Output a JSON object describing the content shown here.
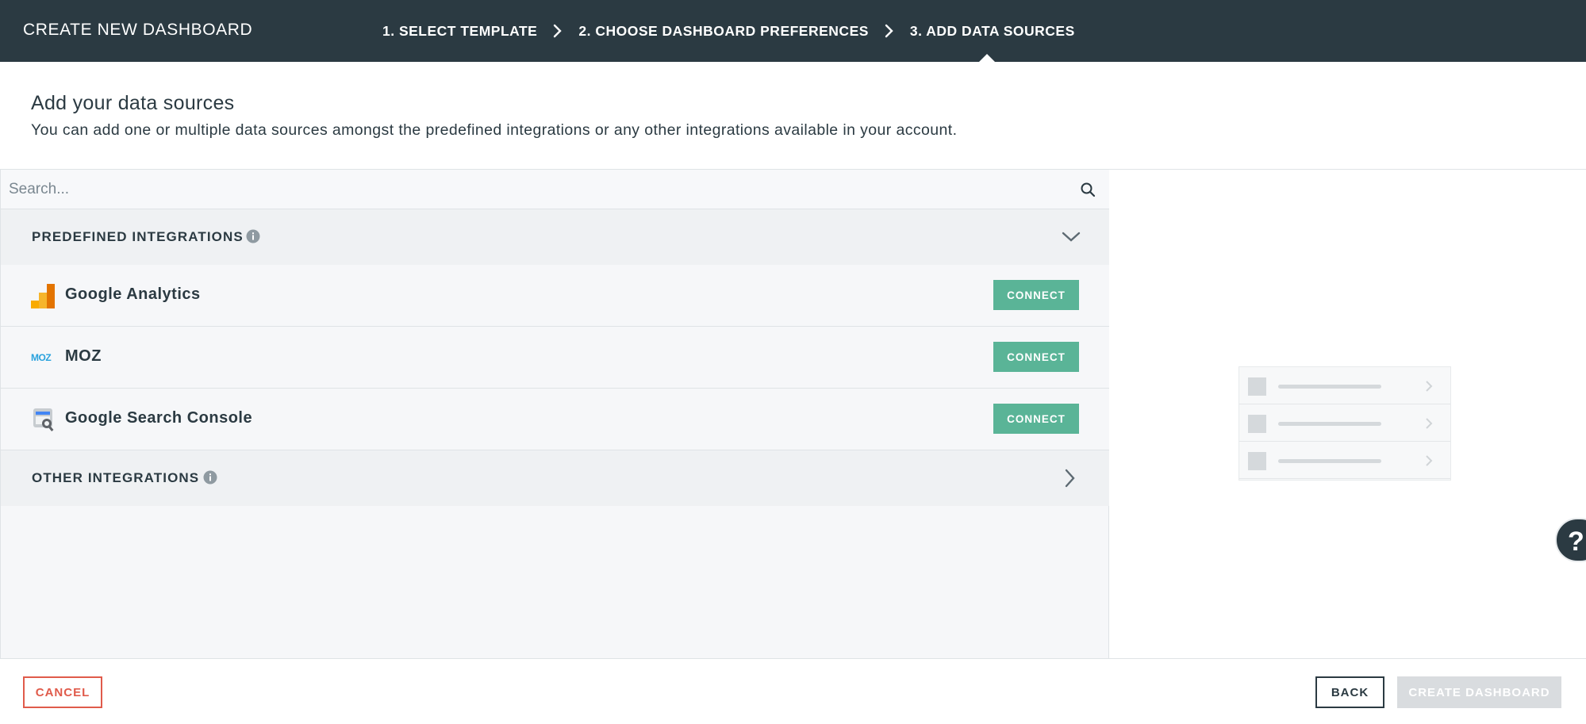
{
  "header": {
    "title": "CREATE NEW DASHBOARD",
    "steps": [
      {
        "label": "1. SELECT TEMPLATE"
      },
      {
        "label": "2. CHOOSE DASHBOARD PREFERENCES"
      },
      {
        "label": "3. ADD DATA SOURCES",
        "active": true
      }
    ]
  },
  "intro": {
    "heading": "Add your data sources",
    "description": "You can add one or multiple data sources amongst the predefined integrations or any other integrations available in your account."
  },
  "search": {
    "placeholder": "Search...",
    "value": ""
  },
  "predefined": {
    "title": "PREDEFINED INTEGRATIONS",
    "expanded": true,
    "items": [
      {
        "name": "Google Analytics",
        "icon": "google-analytics-icon",
        "action": "CONNECT"
      },
      {
        "name": "MOZ",
        "icon": "moz-icon",
        "action": "CONNECT"
      },
      {
        "name": "Google Search Console",
        "icon": "google-search-console-icon",
        "action": "CONNECT"
      }
    ]
  },
  "other": {
    "title": "OTHER INTEGRATIONS",
    "expanded": false
  },
  "help": {
    "label": "?"
  },
  "footer": {
    "cancel": "CANCEL",
    "back": "BACK",
    "create": "CREATE DASHBOARD"
  },
  "colors": {
    "header_bg": "#2b3a42",
    "connect_green": "#5ab497",
    "cancel_red": "#e05b4b",
    "disabled_gray": "#d9dcdf"
  }
}
